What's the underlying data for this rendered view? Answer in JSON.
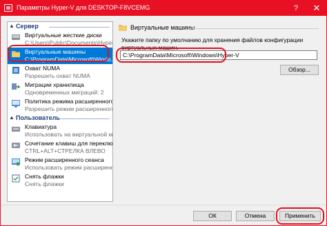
{
  "window": {
    "title": "Параметры Hyper-V для DESKTOP-F8VCEMG",
    "help_glyph": "?",
    "close_glyph": "✕"
  },
  "sidebar": {
    "sections": [
      {
        "label": "Сервер",
        "items": [
          {
            "name": "Виртуальные жесткие диски",
            "sub": "C:\\Users\\Public\\Documents\\Hyper-...",
            "icon": "disk-icon",
            "selected": false
          },
          {
            "name": "Виртуальные машины",
            "sub": "C:\\ProgramData\\Microsoft\\Windo...",
            "icon": "folder-icon",
            "selected": true
          },
          {
            "name": "Охват NUMA",
            "sub": "Разрешить охват NUMA",
            "icon": "numa-icon",
            "selected": false
          },
          {
            "name": "Миграции хранилища",
            "sub": "Одновременных миграций: 2",
            "icon": "migration-icon",
            "selected": false
          },
          {
            "name": "Политика режима расширенного...",
            "sub": "Разрешить режим расширенного с...",
            "icon": "policy-icon",
            "selected": false
          }
        ]
      },
      {
        "label": "Пользователь",
        "items": [
          {
            "name": "Клавиатура",
            "sub": "Использовать на виртуальной маши...",
            "icon": "keyboard-icon",
            "selected": false
          },
          {
            "name": "Сочетание клавиш для переклю...",
            "sub": "CTRL+ALT+СТРЕЛКА ВЛЕВО",
            "icon": "hotkey-icon",
            "selected": false
          },
          {
            "name": "Режим расширенного сеанса",
            "sub": "Использовать режим расширенно...",
            "icon": "session-icon",
            "selected": false
          },
          {
            "name": "Снять флажки",
            "sub": "Снять флажки",
            "icon": "checkbox-icon",
            "selected": false
          }
        ]
      }
    ]
  },
  "panel": {
    "header": "Виртуальные машины",
    "description": "Укажите папку по умолчанию для хранения файлов конфигурации виртуальных машин.",
    "path_value": "C:\\ProgramData\\Microsoft\\Windows\\Hyper-V",
    "browse_label": "Обзор..."
  },
  "footer": {
    "ok_label": "ОК",
    "cancel_label": "Отмена",
    "apply_label": "Применить"
  },
  "colors": {
    "titlebar": "#e81123",
    "selection": "#0078d7",
    "section_text": "#1e3f7a",
    "highlight": "#e0101c"
  }
}
